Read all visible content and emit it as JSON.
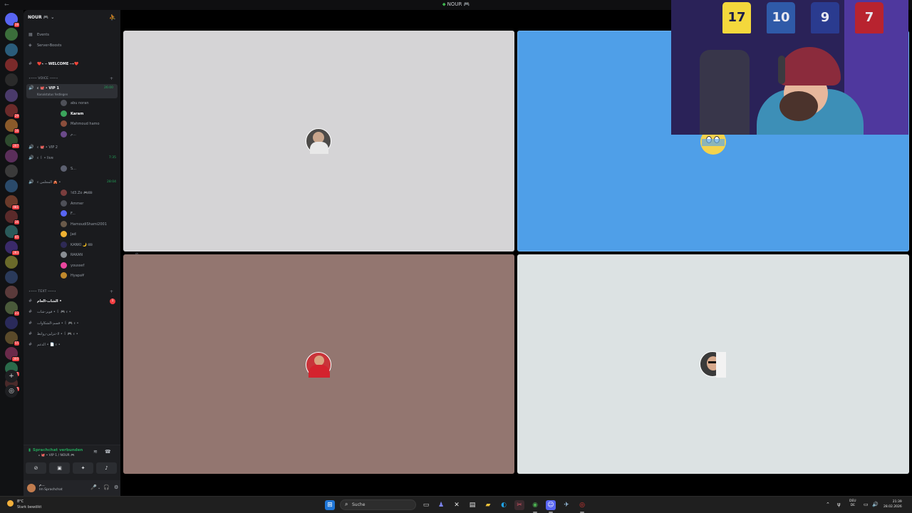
{
  "window": {
    "title": "NOUR",
    "title_gem": "🎮"
  },
  "guild": {
    "name": "NOUR",
    "gem": "🎮"
  },
  "sidebar_links": [
    {
      "label": "Events"
    },
    {
      "label": "Server-Boosts"
    }
  ],
  "channels": {
    "welcome": "❤️‍⋆ ─ WELCOME ─⋆‍❤️",
    "voice_category": "⋆─── VOICE ───⋆",
    "vip1": {
      "name": "VIP 1",
      "prefix": "ء 🐙 •",
      "time": "26:00",
      "status": "Kanalstatus festlegen"
    },
    "vip2": {
      "name": "VIP 2",
      "prefix": "ء 🐙 •"
    },
    "live": {
      "name": "live",
      "prefix": "ء ꒰ •",
      "time": "7:35"
    },
    "rooms": {
      "name": "المجلس",
      "prefix": "ء 🎪 •",
      "time": "28:04"
    },
    "text_category": "⋆─── TEXT ───⋆",
    "text_channels": [
      {
        "name": "الشات-العام •",
        "unread": "1"
      },
      {
        "name": "ء 🎮 ꒰ • فويز-شات •"
      },
      {
        "name": "ء 🎮 ꒰ • قسم-الشكاوات •"
      },
      {
        "name": "ء 🎮 ꒰ • لا-تنزلين-روابط •"
      },
      {
        "name": "ء 📄 • الدعم •"
      }
    ]
  },
  "vip1_members": [
    {
      "name": "abu noran",
      "color": "#4e5058"
    },
    {
      "name": "Karam",
      "color": "#3ba55c",
      "bright": true
    },
    {
      "name": "Mahmoud hamo",
      "color": "#8b4e3c",
      "badge": "⇩"
    },
    {
      "name": "م...",
      "color": "#6b4a8a"
    }
  ],
  "live_members": [
    {
      "name": "S...",
      "color": "#5c6070"
    }
  ],
  "rooms_members": [
    {
      "name": "!d3.Zo 🎮🎟",
      "color": "#7a3d3d"
    },
    {
      "name": "Ammer",
      "color": "#4e5058"
    },
    {
      "name": "F...",
      "color": "#5865f2"
    },
    {
      "name": "HamoudiShami2001",
      "color": "#6a5a4a"
    },
    {
      "name": "Jad",
      "color": "#f0b232"
    },
    {
      "name": "KANKI 🌙 🎟",
      "color": "#2e2a55"
    },
    {
      "name": "RAKAN",
      "color": "#8a8e94"
    },
    {
      "name": "youssef",
      "color": "#eb459e"
    },
    {
      "name": "Hyapa¥",
      "color": "#c0892c"
    }
  ],
  "voice_panel": {
    "status": "Sprachchat verbunden",
    "channel": "ء 🐙 • VIP 1 / NOUR 🎮"
  },
  "user_panel": {
    "name": "م...",
    "status": "Im Sprachchat"
  },
  "server_badges": [
    "38",
    "",
    "",
    "",
    "",
    "",
    "29",
    "16",
    "207",
    "",
    "",
    "",
    "481",
    "36",
    "45",
    "283",
    "",
    "",
    "",
    "23",
    "",
    "55",
    "300",
    "321",
    "306"
  ],
  "webcam": {
    "jerseys": [
      {
        "number": "17",
        "color": "#f4d83c"
      },
      {
        "number": "10",
        "color": "#2f5aa8"
      },
      {
        "number": "9",
        "color": "#2a3b8f"
      },
      {
        "number": "7",
        "color": "#b8232f"
      }
    ]
  },
  "taskbar": {
    "weather_temp": "8°C",
    "weather_desc": "Stark bewölkt",
    "search_placeholder": "Suche",
    "lang_top": "DEU",
    "lang_bottom": "DE",
    "time": "21:39",
    "date": "28.02.2026"
  },
  "colors": {
    "tile_top_left": "#d5d4d6",
    "tile_top_right": "#4f9fe8",
    "tile_bottom_left": "#937670",
    "tile_bottom_right": "#dce2e3",
    "connected_green": "#23a55a"
  }
}
